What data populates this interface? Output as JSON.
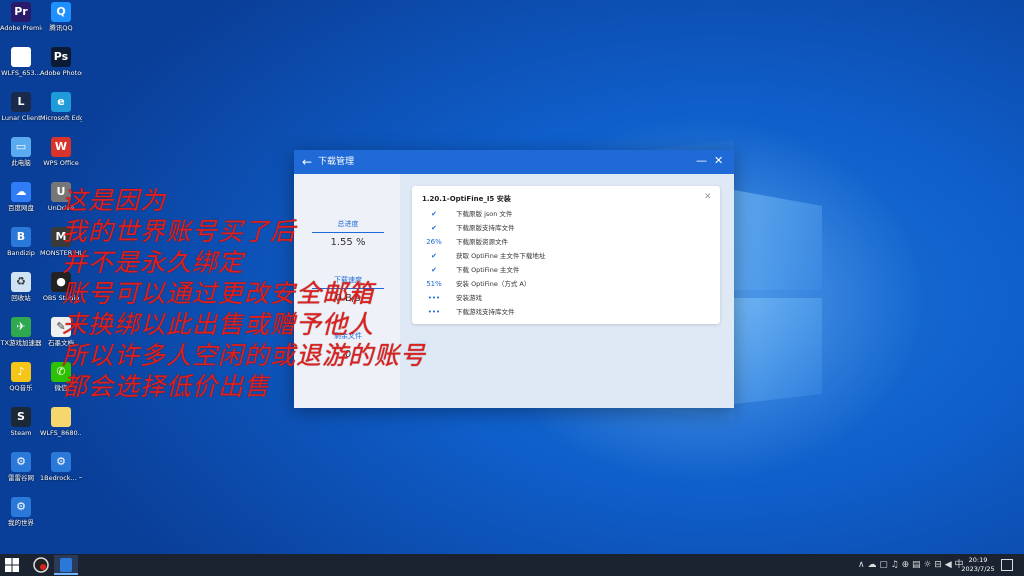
{
  "desktop_icons": [
    {
      "label": "Adobe Premier...",
      "icon": "premiere-icon",
      "color": "#2a1a6b",
      "glyph": "Pr"
    },
    {
      "label": "腾讯QQ",
      "icon": "qq-icon",
      "color": "#1e90ff",
      "glyph": "Q"
    },
    {
      "label": "WLFS_653...",
      "icon": "file-icon",
      "color": "#ffffff",
      "glyph": ""
    },
    {
      "label": "Adobe Photosh...",
      "icon": "photoshop-icon",
      "color": "#0b1b33",
      "glyph": "Ps"
    },
    {
      "label": "Lunar Client",
      "icon": "lunar-client-icon",
      "color": "#1a2a4a",
      "glyph": "L"
    },
    {
      "label": "Microsoft Edge",
      "icon": "edge-icon",
      "color": "#1f9bd9",
      "glyph": "e"
    },
    {
      "label": "此电脑",
      "icon": "computer-icon",
      "color": "#5aaaf0",
      "glyph": "▭"
    },
    {
      "label": "WPS Office",
      "icon": "wps-icon",
      "color": "#d9342b",
      "glyph": "W"
    },
    {
      "label": "百度网盘",
      "icon": "baidu-netdisk-icon",
      "color": "#2f7cf6",
      "glyph": "☁"
    },
    {
      "label": "UnDrive",
      "icon": "undrive-icon",
      "color": "#777777",
      "glyph": "U"
    },
    {
      "label": "Bandizip",
      "icon": "bandizip-icon",
      "color": "#2a78d8",
      "glyph": "B"
    },
    {
      "label": "MONSTER HUNTER...",
      "icon": "monster-hunter-icon",
      "color": "#3a3a3a",
      "glyph": "M"
    },
    {
      "label": "回收站",
      "icon": "recycle-bin-icon",
      "color": "#cfe3f5",
      "glyph": "♻"
    },
    {
      "label": "OBS Studio",
      "icon": "obs-icon",
      "color": "#222222",
      "glyph": "●"
    },
    {
      "label": "TX游戏加速器",
      "icon": "tx-accelerator-icon",
      "color": "#2fa84f",
      "glyph": "✈"
    },
    {
      "label": "石墨文档",
      "icon": "shimo-icon",
      "color": "#f0f0f0",
      "glyph": "✎"
    },
    {
      "label": "QQ音乐",
      "icon": "qq-music-icon",
      "color": "#f5c518",
      "glyph": "♪"
    },
    {
      "label": "微信",
      "icon": "wechat-icon",
      "color": "#2dc100",
      "glyph": "✆"
    },
    {
      "label": "Steam",
      "icon": "steam-icon",
      "color": "#1b2838",
      "glyph": "S"
    },
    {
      "label": "WLFS_8680...",
      "icon": "file-icon",
      "color": "#f5d76e",
      "glyph": ""
    },
    {
      "label": "雷雷谷网",
      "icon": "leilei-icon",
      "color": "#2a78d8",
      "glyph": "⚙"
    },
    {
      "label": "1Bedrock... 一键启动",
      "icon": "bedrock-launcher-icon",
      "color": "#2a78d8",
      "glyph": "⚙"
    },
    {
      "label": "我的世界",
      "icon": "minecraft-launcher-icon",
      "color": "#2a78d8",
      "glyph": "⚙"
    }
  ],
  "window": {
    "title": "下载管理",
    "back_symbol": "←",
    "minimize_symbol": "—",
    "close_symbol": "✕",
    "left": {
      "progress_label": "总进度",
      "progress_value": "1.55 %",
      "speed_label": "下载速度",
      "speed_value": "0 B/s",
      "files_label": "剩余文件",
      "files_value": "0"
    },
    "card": {
      "title": "1.20.1-OptiFine_I5 安装",
      "close_symbol": "✕",
      "tasks": [
        {
          "mark": "✔",
          "text": "下载原版 json 文件"
        },
        {
          "mark": "✔",
          "text": "下载原版支持库文件"
        },
        {
          "mark": "26%",
          "text": "下载原版资源文件"
        },
        {
          "mark": "✔",
          "text": "获取 OptiFine 主文件下载地址"
        },
        {
          "mark": "✔",
          "text": "下载 OptiFine 主文件"
        },
        {
          "mark": "51%",
          "text": "安装 OptiFine（方式 A）"
        },
        {
          "mark": "•••",
          "text": "安装游戏"
        },
        {
          "mark": "•••",
          "text": "下载游戏支持库文件"
        }
      ]
    }
  },
  "overlay_lines": [
    "这是因为",
    "我的世界账号买了后",
    "并不是永久绑定",
    "账号可以通过更改安全邮箱",
    "来换绑以此出售或赠予他人",
    "所以许多人空闲的或退游的账号",
    "都会选择低价出售"
  ],
  "taskbar": {
    "tray_symbols": "∧ ☁ ▢ ♫ ⊕ ▤ ☼ ⊟ ◀ 中",
    "time": "20:19",
    "date": "2023/7/25"
  }
}
